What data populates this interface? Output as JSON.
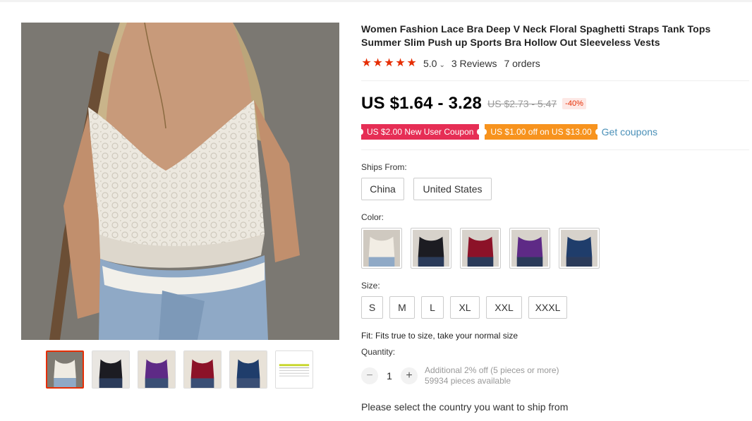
{
  "product": {
    "title": "Women Fashion Lace Bra Deep V Neck Floral Spaghetti Straps Tank Tops Summer Slim Push up Sports Bra Hollow Out Sleeveless Vests",
    "rating": "5.0",
    "reviews": "3 Reviews",
    "orders": "7 orders",
    "price": "US $1.64 - 3.28",
    "original_price": "US $2.73 - 5.47",
    "discount": "-40%"
  },
  "coupons": {
    "new_user": "US $2.00 New User Coupon",
    "store": "US $1.00 off on US $13.00",
    "get_coupons": "Get coupons"
  },
  "ships_from": {
    "label": "Ships From:",
    "options": [
      "China",
      "United States"
    ]
  },
  "color": {
    "label": "Color:",
    "swatches": [
      {
        "name": "white",
        "hex": "#f2ede4"
      },
      {
        "name": "black",
        "hex": "#1c1c22"
      },
      {
        "name": "wine-red",
        "hex": "#8c1228"
      },
      {
        "name": "purple",
        "hex": "#5e2a86"
      },
      {
        "name": "navy",
        "hex": "#1f3d6b"
      }
    ]
  },
  "size": {
    "label": "Size:",
    "options": [
      "S",
      "M",
      "L",
      "XL",
      "XXL",
      "XXXL"
    ]
  },
  "fit": "Fit: Fits true to size, take your normal size",
  "quantity": {
    "label": "Quantity:",
    "value": "1",
    "minus": "−",
    "plus": "+",
    "discount_note": "Additional 2% off (5 pieces or more)",
    "available": "59934 pieces available"
  },
  "ship_message": "Please select the country you want to ship from",
  "gallery": {
    "thumbnails": [
      "white",
      "black",
      "purple",
      "wine-red",
      "navy",
      "size-chart"
    ]
  },
  "colors": {
    "accent": "#e62e04",
    "coupon_red": "#e62e55",
    "coupon_orange": "#f7931e",
    "link": "#4a90b8"
  }
}
